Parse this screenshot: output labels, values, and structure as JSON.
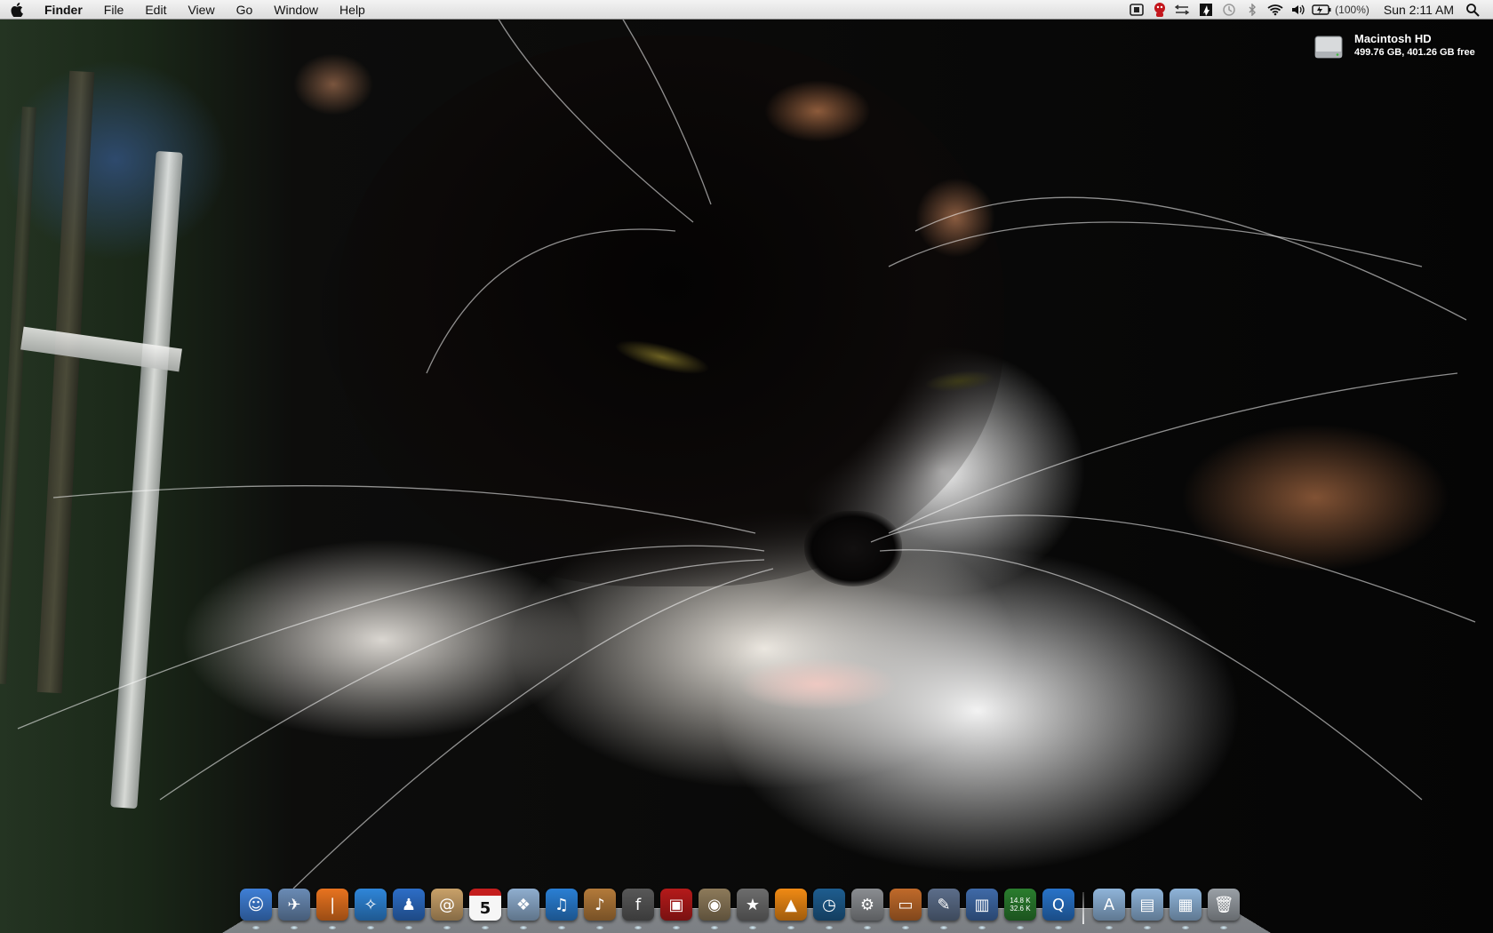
{
  "menubar": {
    "app_name": "Finder",
    "menus": [
      "File",
      "Edit",
      "View",
      "Go",
      "Window",
      "Help"
    ],
    "battery_percent": "(100%)",
    "clock": "Sun 2:11 AM",
    "status_icons": [
      "airport-express-icon",
      "growl-icon",
      "network-meter-icon",
      "keyboard-brightness-icon",
      "time-machine-icon",
      "bluetooth-icon",
      "wifi-icon",
      "volume-icon",
      "battery-icon",
      "spotlight-icon"
    ]
  },
  "desktop": {
    "drive": {
      "name": "Macintosh HD",
      "info": "499.76 GB, 401.26 GB free"
    }
  },
  "dock": {
    "network_meter_upper": "14.8 K",
    "network_meter_lower": "32.6 K",
    "calendar_day": "5",
    "apps": [
      {
        "name": "finder",
        "color": "#3f7fd6",
        "glyph": "☺"
      },
      {
        "name": "preview",
        "color": "#6a8bb5",
        "glyph": "✈"
      },
      {
        "name": "rss-reader",
        "color": "#e8731f",
        "glyph": "❘"
      },
      {
        "name": "safari",
        "color": "#2f86d9",
        "glyph": "✧"
      },
      {
        "name": "adium",
        "color": "#2d6ec7",
        "glyph": "♟"
      },
      {
        "name": "address-book",
        "color": "#c9a169",
        "glyph": "@"
      },
      {
        "name": "ical",
        "color": "#f4f4f4",
        "glyph": ""
      },
      {
        "name": "iphoto",
        "color": "#8faecf",
        "glyph": "❖"
      },
      {
        "name": "itunes",
        "color": "#2a7fd4",
        "glyph": "♫"
      },
      {
        "name": "garageband",
        "color": "#b37a3a",
        "glyph": "♪"
      },
      {
        "name": "font-book",
        "color": "#585858",
        "glyph": "f"
      },
      {
        "name": "photo-booth",
        "color": "#b51a1a",
        "glyph": "▣"
      },
      {
        "name": "image-capture",
        "color": "#8d7a5a",
        "glyph": "◉"
      },
      {
        "name": "imovie",
        "color": "#6d6d6d",
        "glyph": "★"
      },
      {
        "name": "vlc",
        "color": "#f08a14",
        "glyph": "▲"
      },
      {
        "name": "time-machine",
        "color": "#1e5d8f",
        "glyph": "◷"
      },
      {
        "name": "system-preferences",
        "color": "#8a8d91",
        "glyph": "⚙"
      },
      {
        "name": "keynote",
        "color": "#c06a2a",
        "glyph": "▭"
      },
      {
        "name": "script-editor",
        "color": "#5c6e8a",
        "glyph": "✎"
      },
      {
        "name": "numbers",
        "color": "#3f6aa8",
        "glyph": "▥"
      },
      {
        "name": "network-meter",
        "color": "#2a7d2e",
        "glyph": ""
      },
      {
        "name": "quicktime",
        "color": "#2873c9",
        "glyph": "Q"
      }
    ],
    "stacks": [
      {
        "name": "applications-folder",
        "color": "#8fb4d9",
        "glyph": "A"
      },
      {
        "name": "documents-folder",
        "color": "#8fb4d9",
        "glyph": "▤"
      },
      {
        "name": "downloads-folder",
        "color": "#8fb4d9",
        "glyph": "▦"
      },
      {
        "name": "trash",
        "color": "#9aa0a6",
        "glyph": "🗑"
      }
    ]
  }
}
